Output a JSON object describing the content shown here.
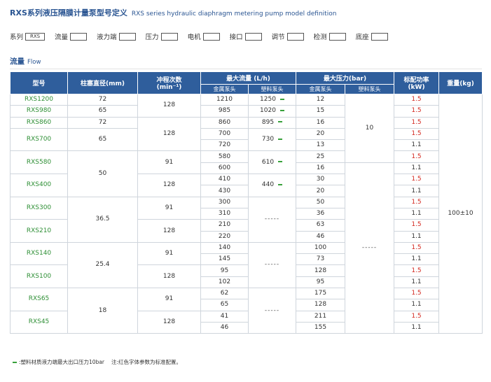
{
  "title": {
    "cn": "RXS系列液压隔膜计量泵型号定义",
    "en": "RXS series hydraulic diaphragm metering pump model definition"
  },
  "model_def": [
    {
      "label": "系列",
      "value": "RXS"
    },
    {
      "label": "流量",
      "value": ""
    },
    {
      "label": "液力端",
      "value": ""
    },
    {
      "label": "压力",
      "value": ""
    },
    {
      "label": "电机",
      "value": ""
    },
    {
      "label": "接口",
      "value": ""
    },
    {
      "label": "调节",
      "value": ""
    },
    {
      "label": "检测",
      "value": ""
    },
    {
      "label": "底座",
      "value": ""
    }
  ],
  "section": {
    "cn": "流量",
    "en": "Flow"
  },
  "headers": {
    "model": "型号",
    "plunger": "柱塞直径(mm)",
    "stroke": "冲程次数",
    "stroke_unit": "(min⁻¹)",
    "flow": "最大流量 (L/h)",
    "pressure": "最大压力(bar)",
    "power": "标配功率",
    "power_unit": "(kW)",
    "weight": "重量(kg)",
    "metal_head": "金属泵头",
    "plastic_head": "塑料泵头"
  },
  "models": [
    "RXS1200",
    "RXS980",
    "RXS860",
    "RXS700",
    "RXS580",
    "RXS400",
    "RXS300",
    "RXS210",
    "RXS140",
    "RXS100",
    "RXS65",
    "RXS45"
  ],
  "plunger": [
    "72",
    "65",
    "72",
    "65",
    "50",
    "36.5",
    "25.4",
    "18"
  ],
  "stroke": [
    "128",
    "128",
    "91",
    "128",
    "91",
    "128",
    "91",
    "128",
    "91",
    "128",
    "91"
  ],
  "flow_metal": [
    "1210",
    "985",
    "860",
    "700",
    "720",
    "580",
    "600",
    "410",
    "430",
    "300",
    "310",
    "210",
    "220",
    "140",
    "145",
    "95",
    "102",
    "62",
    "65",
    "41",
    "46"
  ],
  "flow_plastic": [
    "1250",
    "1020",
    "895",
    "730",
    "610",
    "440"
  ],
  "dash": "-----",
  "pressure_metal": [
    "12",
    "15",
    "16",
    "20",
    "13",
    "25",
    "16",
    "30",
    "20",
    "50",
    "36",
    "63",
    "46",
    "100",
    "73",
    "128",
    "95",
    "175",
    "128",
    "211",
    "155"
  ],
  "pressure_plastic": "10",
  "power": [
    "1.5",
    "1.5",
    "1.5",
    "1.5",
    "1.1",
    "1.5",
    "1.1",
    "1.5",
    "1.1",
    "1.5",
    "1.1",
    "1.5",
    "1.1",
    "1.5",
    "1.1",
    "1.5",
    "1.1",
    "1.5",
    "1.1",
    "1.5",
    "1.1"
  ],
  "weight": "100±10",
  "notes": {
    "n1": ":塑料材质液力端最大出口压力10bar",
    "n2": "注:红色字体参数为标准配置。"
  },
  "colors": {
    "header": "#2f5e9c",
    "title": "#2a5592",
    "model_text": "#2e8f35",
    "standard_red": "#d3261d",
    "marker_green": "#38a13b"
  }
}
